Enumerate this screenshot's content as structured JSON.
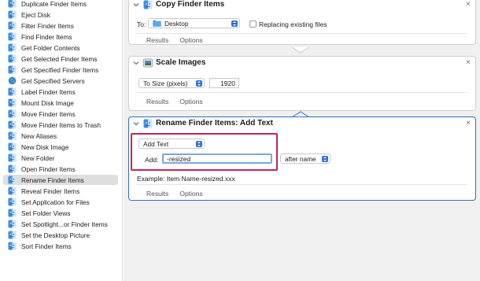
{
  "sidebar": {
    "items": [
      {
        "label": "Duplicate Finder Items",
        "icon": "finder-icon"
      },
      {
        "label": "Eject Disk",
        "icon": "finder-icon"
      },
      {
        "label": "Filter Finder Items",
        "icon": "finder-icon"
      },
      {
        "label": "Find Finder Items",
        "icon": "finder-icon"
      },
      {
        "label": "Get Folder Contents",
        "icon": "finder-icon"
      },
      {
        "label": "Get Selected Finder Items",
        "icon": "finder-icon"
      },
      {
        "label": "Get Specified Finder Items",
        "icon": "finder-icon"
      },
      {
        "label": "Get Specified Servers",
        "icon": "globe-icon"
      },
      {
        "label": "Label Finder Items",
        "icon": "finder-icon"
      },
      {
        "label": "Mount Disk Image",
        "icon": "finder-icon"
      },
      {
        "label": "Move Finder Items",
        "icon": "finder-icon"
      },
      {
        "label": "Move Finder Items to Trash",
        "icon": "finder-icon"
      },
      {
        "label": "New Aliases",
        "icon": "finder-icon"
      },
      {
        "label": "New Disk Image",
        "icon": "finder-icon"
      },
      {
        "label": "New Folder",
        "icon": "finder-icon"
      },
      {
        "label": "Open Finder Items",
        "icon": "finder-icon"
      },
      {
        "label": "Rename Finder Items",
        "icon": "finder-icon",
        "selected": true
      },
      {
        "label": "Reveal Finder Items",
        "icon": "finder-icon"
      },
      {
        "label": "Set Application for Files",
        "icon": "finder-icon"
      },
      {
        "label": "Set Folder Views",
        "icon": "finder-icon"
      },
      {
        "label": "Set Spotlight...or Finder Items",
        "icon": "finder-icon"
      },
      {
        "label": "Set the Desktop Picture",
        "icon": "finder-icon"
      },
      {
        "label": "Sort Finder Items",
        "icon": "finder-icon"
      }
    ]
  },
  "workflow": {
    "copy": {
      "title": "Copy Finder Items",
      "to_label": "To:",
      "to_value": "Desktop",
      "replace_label": "Replacing existing files",
      "results": "Results",
      "options": "Options"
    },
    "scale": {
      "title": "Scale Images",
      "mode_value": "To Size (pixels)",
      "size_value": "1920",
      "results": "Results",
      "options": "Options"
    },
    "rename": {
      "title": "Rename Finder Items: Add Text",
      "action_value": "Add Text",
      "add_label": "Add:",
      "add_value": "-resized",
      "position_value": "after name",
      "example": "Example:  Item Name-resized.xxx",
      "results": "Results",
      "options": "Options"
    },
    "close_glyph": "×"
  },
  "colors": {
    "accent": "#2f6fbf",
    "highlight": "#c4245a",
    "selected_bg": "#dedede",
    "finder_blue": "#3b8ee8"
  }
}
